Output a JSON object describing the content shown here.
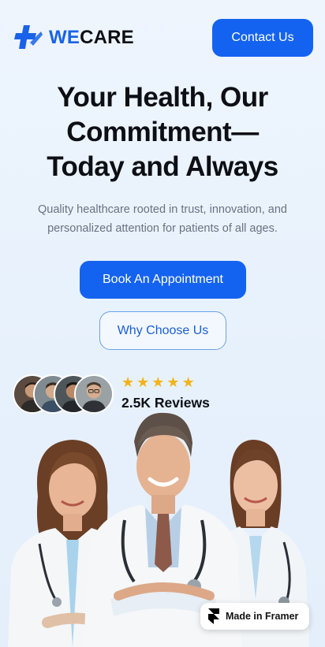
{
  "header": {
    "logo_we": "WE",
    "logo_care": "CARE",
    "contact_label": "Contact Us"
  },
  "hero": {
    "title_lines": [
      "Your Health, Our",
      "Commitment—",
      "Today and Always"
    ],
    "subtitle_lines": [
      "Quality healthcare rooted in trust, innovation, and",
      "personalized attention for patients of all ages."
    ],
    "book_label": "Book An Appointment",
    "why_label": "Why Choose Us"
  },
  "reviews": {
    "stars": "★★★★★",
    "count_label": "2.5K Reviews",
    "rating": 5
  },
  "badge": {
    "label": "Made in Framer"
  },
  "colors": {
    "primary": "#1463f0",
    "star": "#f2b31b",
    "background": "#eaf3fc"
  }
}
